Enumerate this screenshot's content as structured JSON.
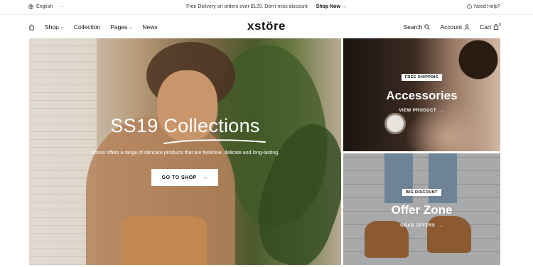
{
  "topbar": {
    "language": "English",
    "language_more": "···",
    "promo": "Free Delivery on orders over $120. Don't miss discount",
    "promo_link": "Shop Now →",
    "help": "Need Help?"
  },
  "nav": {
    "items": [
      {
        "label": "Shop",
        "has_dropdown": true
      },
      {
        "label": "Collection",
        "has_dropdown": false
      },
      {
        "label": "Pages",
        "has_dropdown": true
      },
      {
        "label": "News",
        "has_dropdown": false
      }
    ],
    "logo": "xstöre",
    "search": "Search",
    "account": "Account",
    "cart": "Cart",
    "cart_count": "0",
    "chevron": "⌄"
  },
  "hero": {
    "title": "SS19 Collections",
    "subtitle": "Xstore offers a range of skincare products that are feminine, delicate and long-lasting.",
    "cta": "GO TO SHOP",
    "cta_arrow": "→"
  },
  "panels": {
    "accessories": {
      "badge": "FREE SHIPPING",
      "title": "Accessories",
      "link": "VIEW PRODUCT",
      "arrow": "→"
    },
    "offer": {
      "badge": "BIG DISCOUNT",
      "title": "Offer Zone",
      "link": "GRAB OFFERS",
      "arrow": "→"
    }
  },
  "icons": {
    "globe": "globe-icon",
    "help": "help-circle-icon",
    "home": "home-icon",
    "search": "search-icon",
    "account": "user-icon",
    "cart": "bag-icon"
  }
}
